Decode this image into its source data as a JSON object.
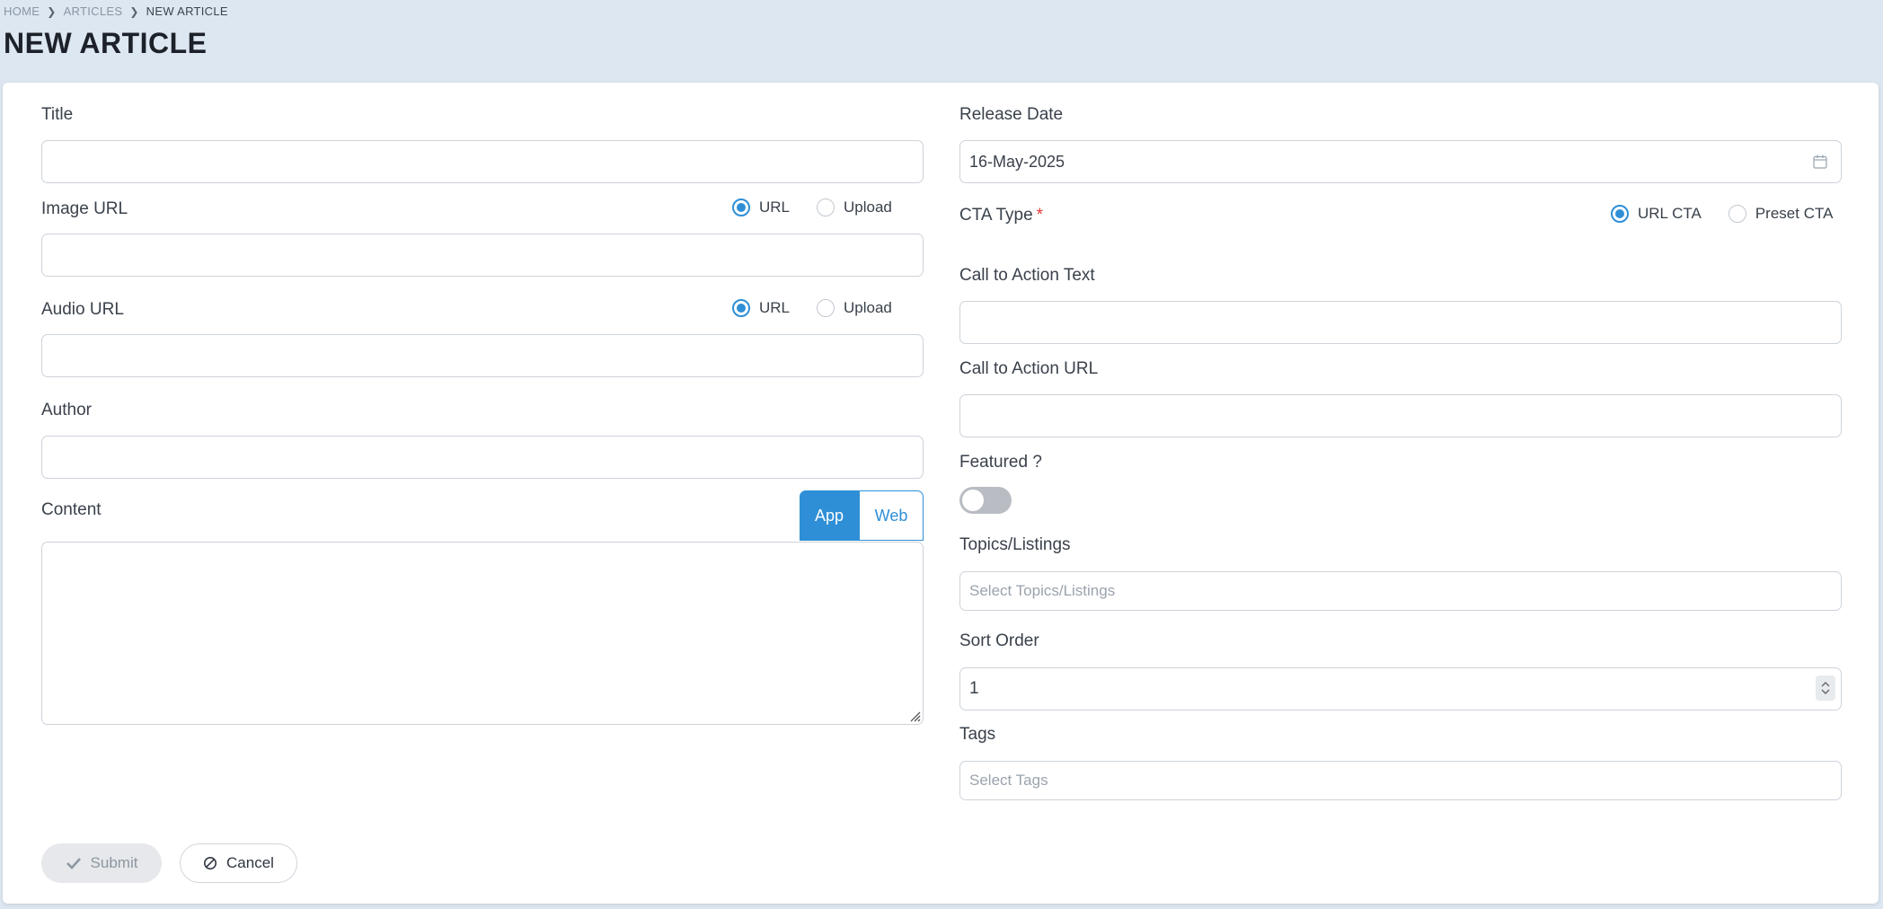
{
  "breadcrumb": {
    "home": "HOME",
    "articles": "ARTICLES",
    "current": "NEW ARTICLE"
  },
  "page_title": "NEW ARTICLE",
  "form": {
    "title_label": "Title",
    "title_value": "",
    "image_url_label": "Image URL",
    "image_source": {
      "options": [
        "URL",
        "Upload"
      ],
      "selected": "URL"
    },
    "image_url_value": "",
    "audio_url_label": "Audio URL",
    "audio_source": {
      "options": [
        "URL",
        "Upload"
      ],
      "selected": "URL"
    },
    "audio_url_value": "",
    "author_label": "Author",
    "author_value": "",
    "content_label": "Content",
    "content_tabs": [
      "App",
      "Web"
    ],
    "content_active_tab": "App",
    "content_value": "",
    "release_date_label": "Release Date",
    "release_date_value": "16-May-2025",
    "cta_type_label": "CTA Type",
    "cta_required_mark": "*",
    "cta_type": {
      "options": [
        "URL CTA",
        "Preset CTA"
      ],
      "selected": "URL CTA"
    },
    "cta_text_label": "Call to Action Text",
    "cta_text_value": "",
    "cta_url_label": "Call to Action URL",
    "cta_url_value": "",
    "featured_label": "Featured ?",
    "featured_on": false,
    "topics_label": "Topics/Listings",
    "topics_placeholder": "Select Topics/Listings",
    "sort_order_label": "Sort Order",
    "sort_order_value": "1",
    "tags_label": "Tags",
    "tags_placeholder": "Select Tags"
  },
  "actions": {
    "submit_label": "Submit",
    "cancel_label": "Cancel"
  },
  "colors": {
    "accent": "#2f8fd6",
    "page_bg": "#dde7f1",
    "required": "#e53935"
  }
}
